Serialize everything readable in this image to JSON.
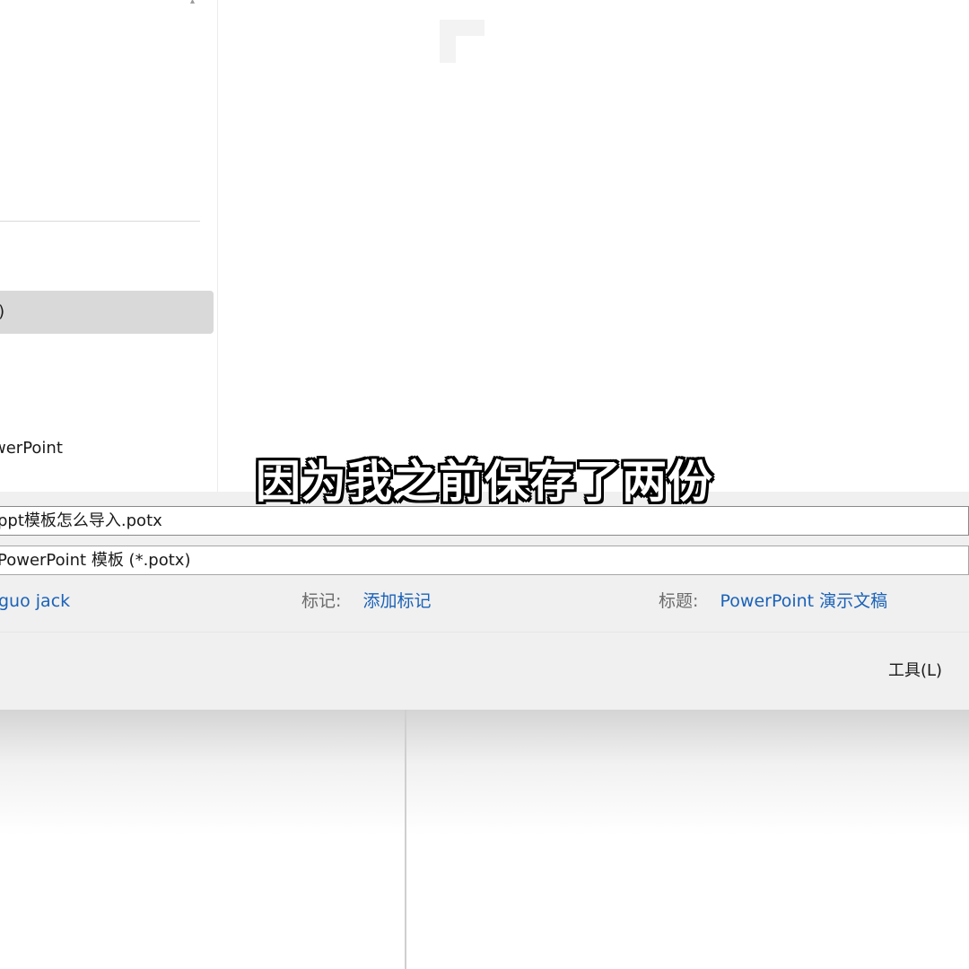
{
  "nav": {
    "items": [
      {
        "label": ":)",
        "selected": true
      },
      {
        "label": ")",
        "selected": false
      },
      {
        "label": "werPoint",
        "selected": false
      }
    ]
  },
  "save_form": {
    "filename": "ppt模板怎么导入.potx",
    "filetype": "PowerPoint 模板 (*.potx)",
    "author_value": "guo jack",
    "tags_label": "标记:",
    "tags_value": "添加标记",
    "title_label": "标题:",
    "title_value": "PowerPoint 演示文稿",
    "tools_label": "工具(L)"
  },
  "subtitle": "因为我之前保存了两份",
  "colors": {
    "link": "#1a62b8",
    "selected_bg": "#d9d9d9",
    "panel_bg": "#f0f0f0"
  }
}
